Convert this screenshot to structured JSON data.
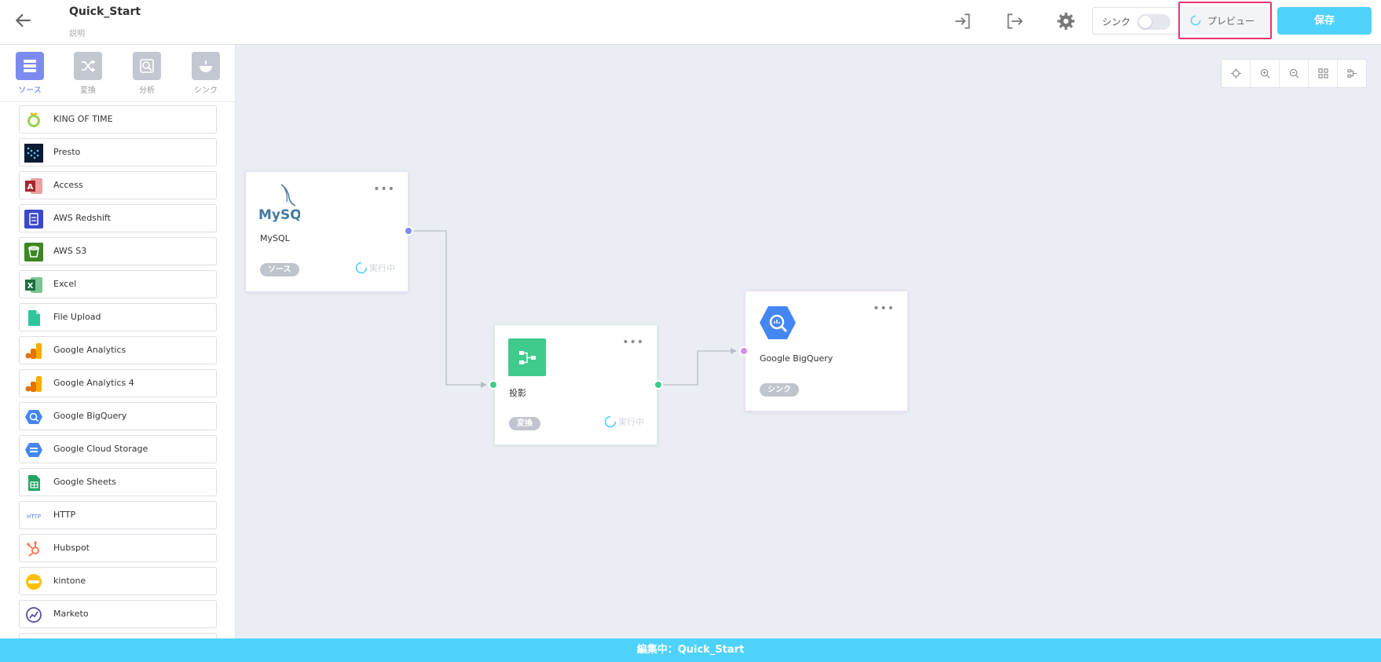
{
  "header": {
    "title": "Quick_Start",
    "description": "説明",
    "sync_label": "シンク",
    "preview_label": "プレビュー",
    "save_label": "保存"
  },
  "sidebar": {
    "categories": [
      {
        "label": "ソース",
        "icon": "database-icon",
        "active": true
      },
      {
        "label": "変換",
        "icon": "shuffle-icon",
        "active": false
      },
      {
        "label": "分析",
        "icon": "analytics-icon",
        "active": false
      },
      {
        "label": "シンク",
        "icon": "sink-icon",
        "active": false
      }
    ],
    "items": [
      {
        "label": "KING OF TIME",
        "icon": "king-of-time-icon"
      },
      {
        "label": "Presto",
        "icon": "presto-icon"
      },
      {
        "label": "Access",
        "icon": "access-icon"
      },
      {
        "label": "AWS Redshift",
        "icon": "aws-redshift-icon"
      },
      {
        "label": "AWS S3",
        "icon": "aws-s3-icon"
      },
      {
        "label": "Excel",
        "icon": "excel-icon"
      },
      {
        "label": "File Upload",
        "icon": "file-upload-icon"
      },
      {
        "label": "Google Analytics",
        "icon": "google-analytics-icon"
      },
      {
        "label": "Google Analytics 4",
        "icon": "google-analytics-4-icon"
      },
      {
        "label": "Google BigQuery",
        "icon": "google-bigquery-icon"
      },
      {
        "label": "Google Cloud Storage",
        "icon": "google-cloud-storage-icon"
      },
      {
        "label": "Google Sheets",
        "icon": "google-sheets-icon"
      },
      {
        "label": "HTTP",
        "icon": "http-icon"
      },
      {
        "label": "Hubspot",
        "icon": "hubspot-icon"
      },
      {
        "label": "kintone",
        "icon": "kintone-icon"
      },
      {
        "label": "Marketo",
        "icon": "marketo-icon"
      }
    ]
  },
  "nodes": {
    "mysql": {
      "name": "MySQL",
      "badge": "ソース",
      "status": "実行中",
      "logo_text": "MySQL"
    },
    "projection": {
      "name": "投影",
      "badge": "変換",
      "status": "実行中"
    },
    "bigquery": {
      "name": "Google BigQuery",
      "badge": "シンク"
    }
  },
  "footer": {
    "text": "編集中：Quick_Start"
  },
  "colors": {
    "accent": "#4fd2f9",
    "active_category": "#7d8bf0",
    "highlight": "#e8336f",
    "transform": "#3ecb8c",
    "bigquery": "#4386f4",
    "sink_port": "#d98cf0",
    "source_port": "#7d8bf0"
  }
}
